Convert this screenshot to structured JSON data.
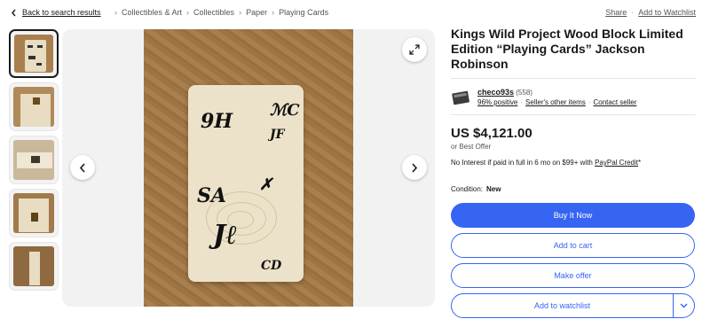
{
  "nav": {
    "back_label": "Back to search results",
    "breadcrumbs": [
      "Collectibles & Art",
      "Collectibles",
      "Paper",
      "Playing Cards"
    ],
    "share_label": "Share",
    "watchlist_link_label": "Add to Watchlist"
  },
  "gallery": {
    "thumbnail_count": 5,
    "active_index": 0,
    "handwriting": [
      "9H",
      "ℳC",
      "JF",
      "SA",
      "✗",
      "Jℓ",
      "CD"
    ]
  },
  "listing": {
    "title": "Kings Wild Project Wood Block Limited Edition “Playing Cards” Jackson Robinson",
    "seller": {
      "name": "checo93s",
      "feedback_count": "(558)",
      "positive": "96% positive",
      "other_items": "Seller's other items",
      "contact": "Contact seller"
    },
    "price": "US $4,121.00",
    "best_offer": "or Best Offer",
    "financing_prefix": "No Interest if paid in full in 6 mo on $99+ with ",
    "financing_link": "PayPal Credit",
    "financing_suffix": "*",
    "condition_label": "Condition:",
    "condition_value": "New",
    "buttons": {
      "buy": "Buy It Now",
      "cart": "Add to cart",
      "offer": "Make offer",
      "watch": "Add to watchlist"
    }
  },
  "colors": {
    "accent": "#3665f3",
    "text": "#191919"
  },
  "icons": [
    "chevron-left-icon",
    "expand-icon",
    "arrow-left-icon",
    "arrow-right-icon",
    "chevron-down-icon",
    "seller-store-icon"
  ]
}
